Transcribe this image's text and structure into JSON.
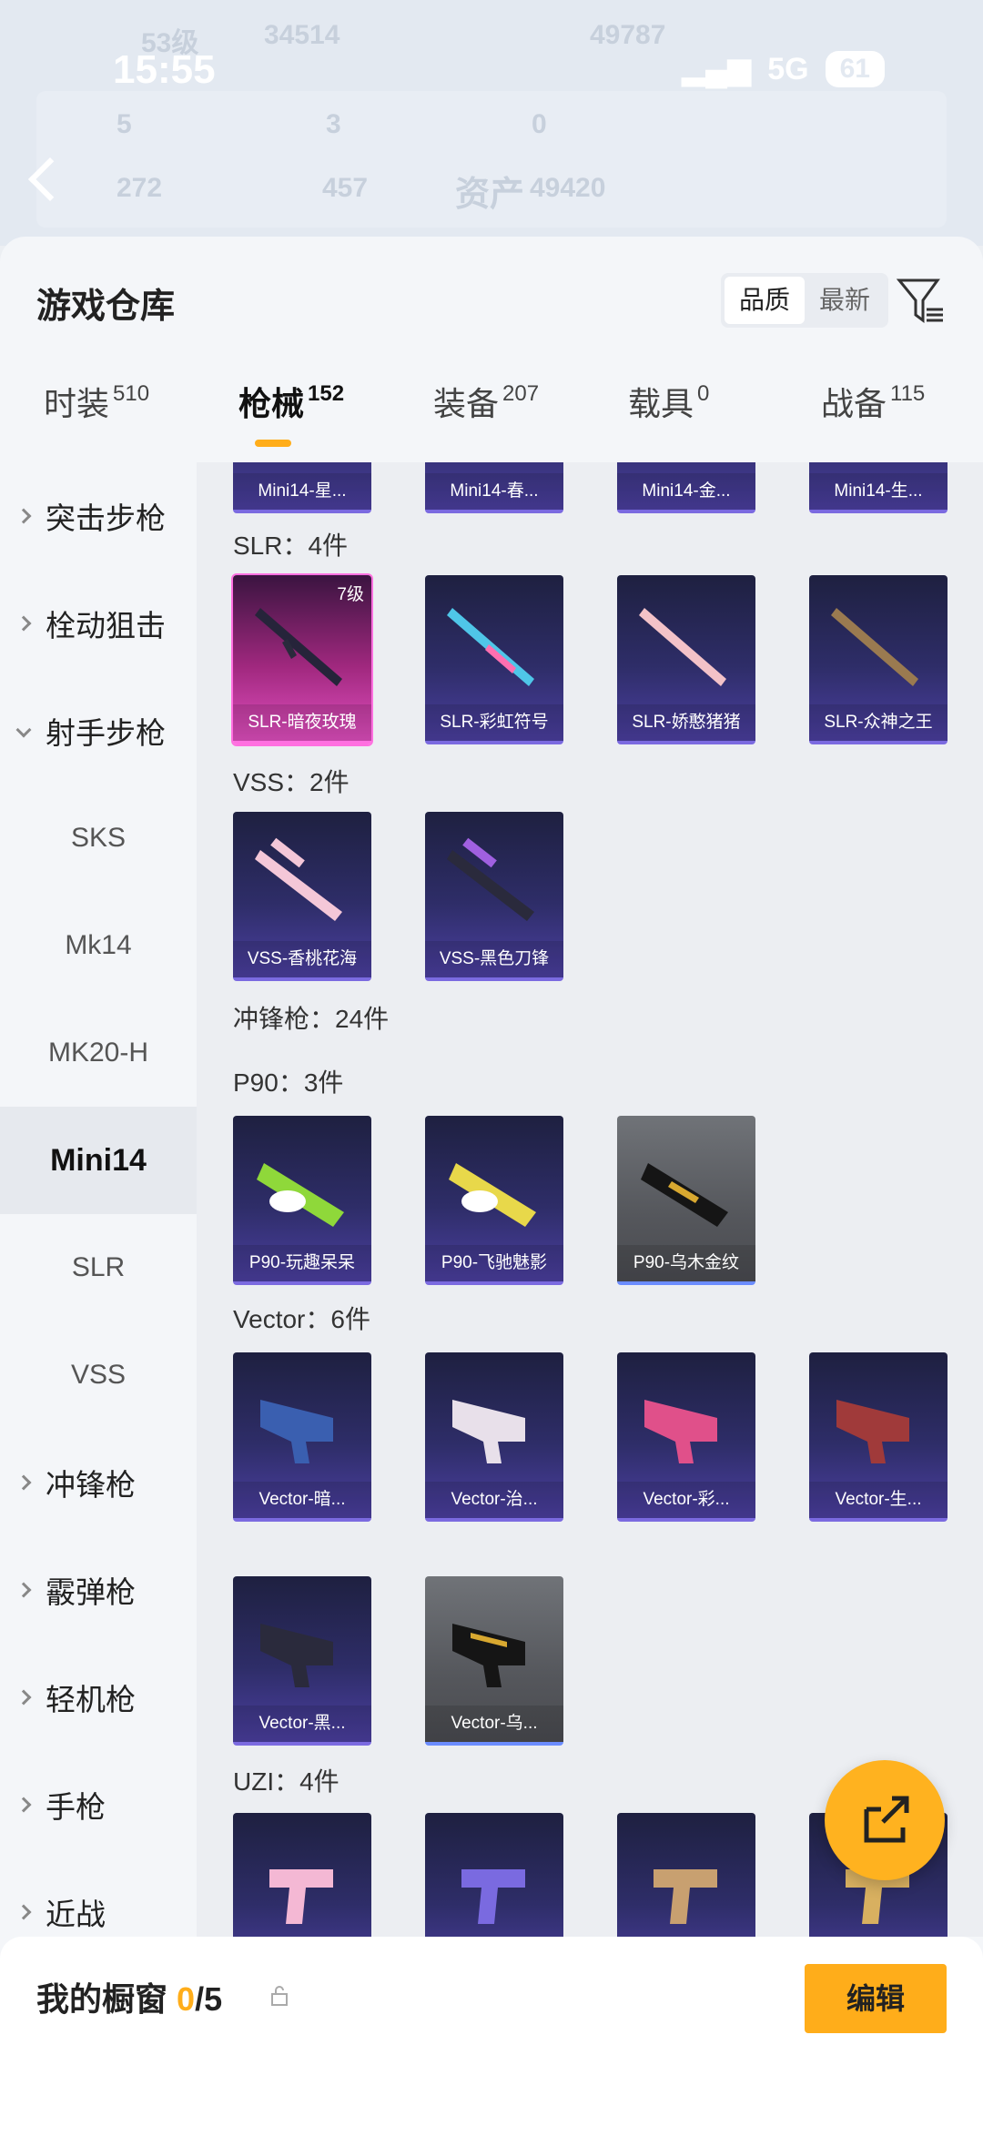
{
  "ghost_header": {
    "level": "53级",
    "coins": "34514",
    "score": "49787",
    "stats_a": [
      "5",
      "3",
      "0"
    ],
    "stats_b": [
      "272",
      "457"
    ],
    "assets_label": "资产",
    "assets_value": "49420"
  },
  "statusbar": {
    "time": "15:55",
    "network": "5G",
    "battery": "61"
  },
  "sheet": {
    "title": "游戏仓库",
    "sort_quality": "品质",
    "sort_latest": "最新"
  },
  "tabs": [
    {
      "label": "时装",
      "count": "510"
    },
    {
      "label": "枪械",
      "count": "152"
    },
    {
      "label": "装备",
      "count": "207"
    },
    {
      "label": "载具",
      "count": "0"
    },
    {
      "label": "战备",
      "count": "115"
    }
  ],
  "sidebar": [
    {
      "label": "突击步枪"
    },
    {
      "label": "栓动狙击"
    },
    {
      "label": "射手步枪"
    },
    {
      "label": "SKS"
    },
    {
      "label": "Mk14"
    },
    {
      "label": "MK20-H"
    },
    {
      "label": "Mini14"
    },
    {
      "label": "SLR"
    },
    {
      "label": "VSS"
    },
    {
      "label": "冲锋枪"
    },
    {
      "label": "霰弹枪"
    },
    {
      "label": "轻机枪"
    },
    {
      "label": "手枪"
    },
    {
      "label": "近战"
    }
  ],
  "sections": {
    "slr": "SLR：4件",
    "vss": "VSS：2件",
    "smg": "冲锋枪：24件",
    "p90": "P90：3件",
    "vector": "Vector：6件",
    "uzi": "UZI：4件"
  },
  "cards": {
    "mini14": [
      "Mini14-星...",
      "Mini14-春...",
      "Mini14-金...",
      "Mini14-生..."
    ],
    "slr": [
      "SLR-暗夜玫瑰",
      "SLR-彩虹符号",
      "SLR-娇憨猪猪",
      "SLR-众神之王"
    ],
    "slr_level": "7级",
    "vss": [
      "VSS-香桃花海",
      "VSS-黑色刀锋"
    ],
    "p90": [
      "P90-玩趣呆呆",
      "P90-飞驰魅影",
      "P90-乌木金纹"
    ],
    "vector": [
      "Vector-暗...",
      "Vector-治...",
      "Vector-彩...",
      "Vector-生...",
      "Vector-黑...",
      "Vector-乌..."
    ]
  },
  "showcase": {
    "title": "我的橱窗",
    "count": "0",
    "total": "/5",
    "edit": "编辑"
  },
  "colors": {
    "accent": "#ffad1a",
    "card_purple": "#4b3fa0",
    "card_pink": "#e04fbf"
  }
}
